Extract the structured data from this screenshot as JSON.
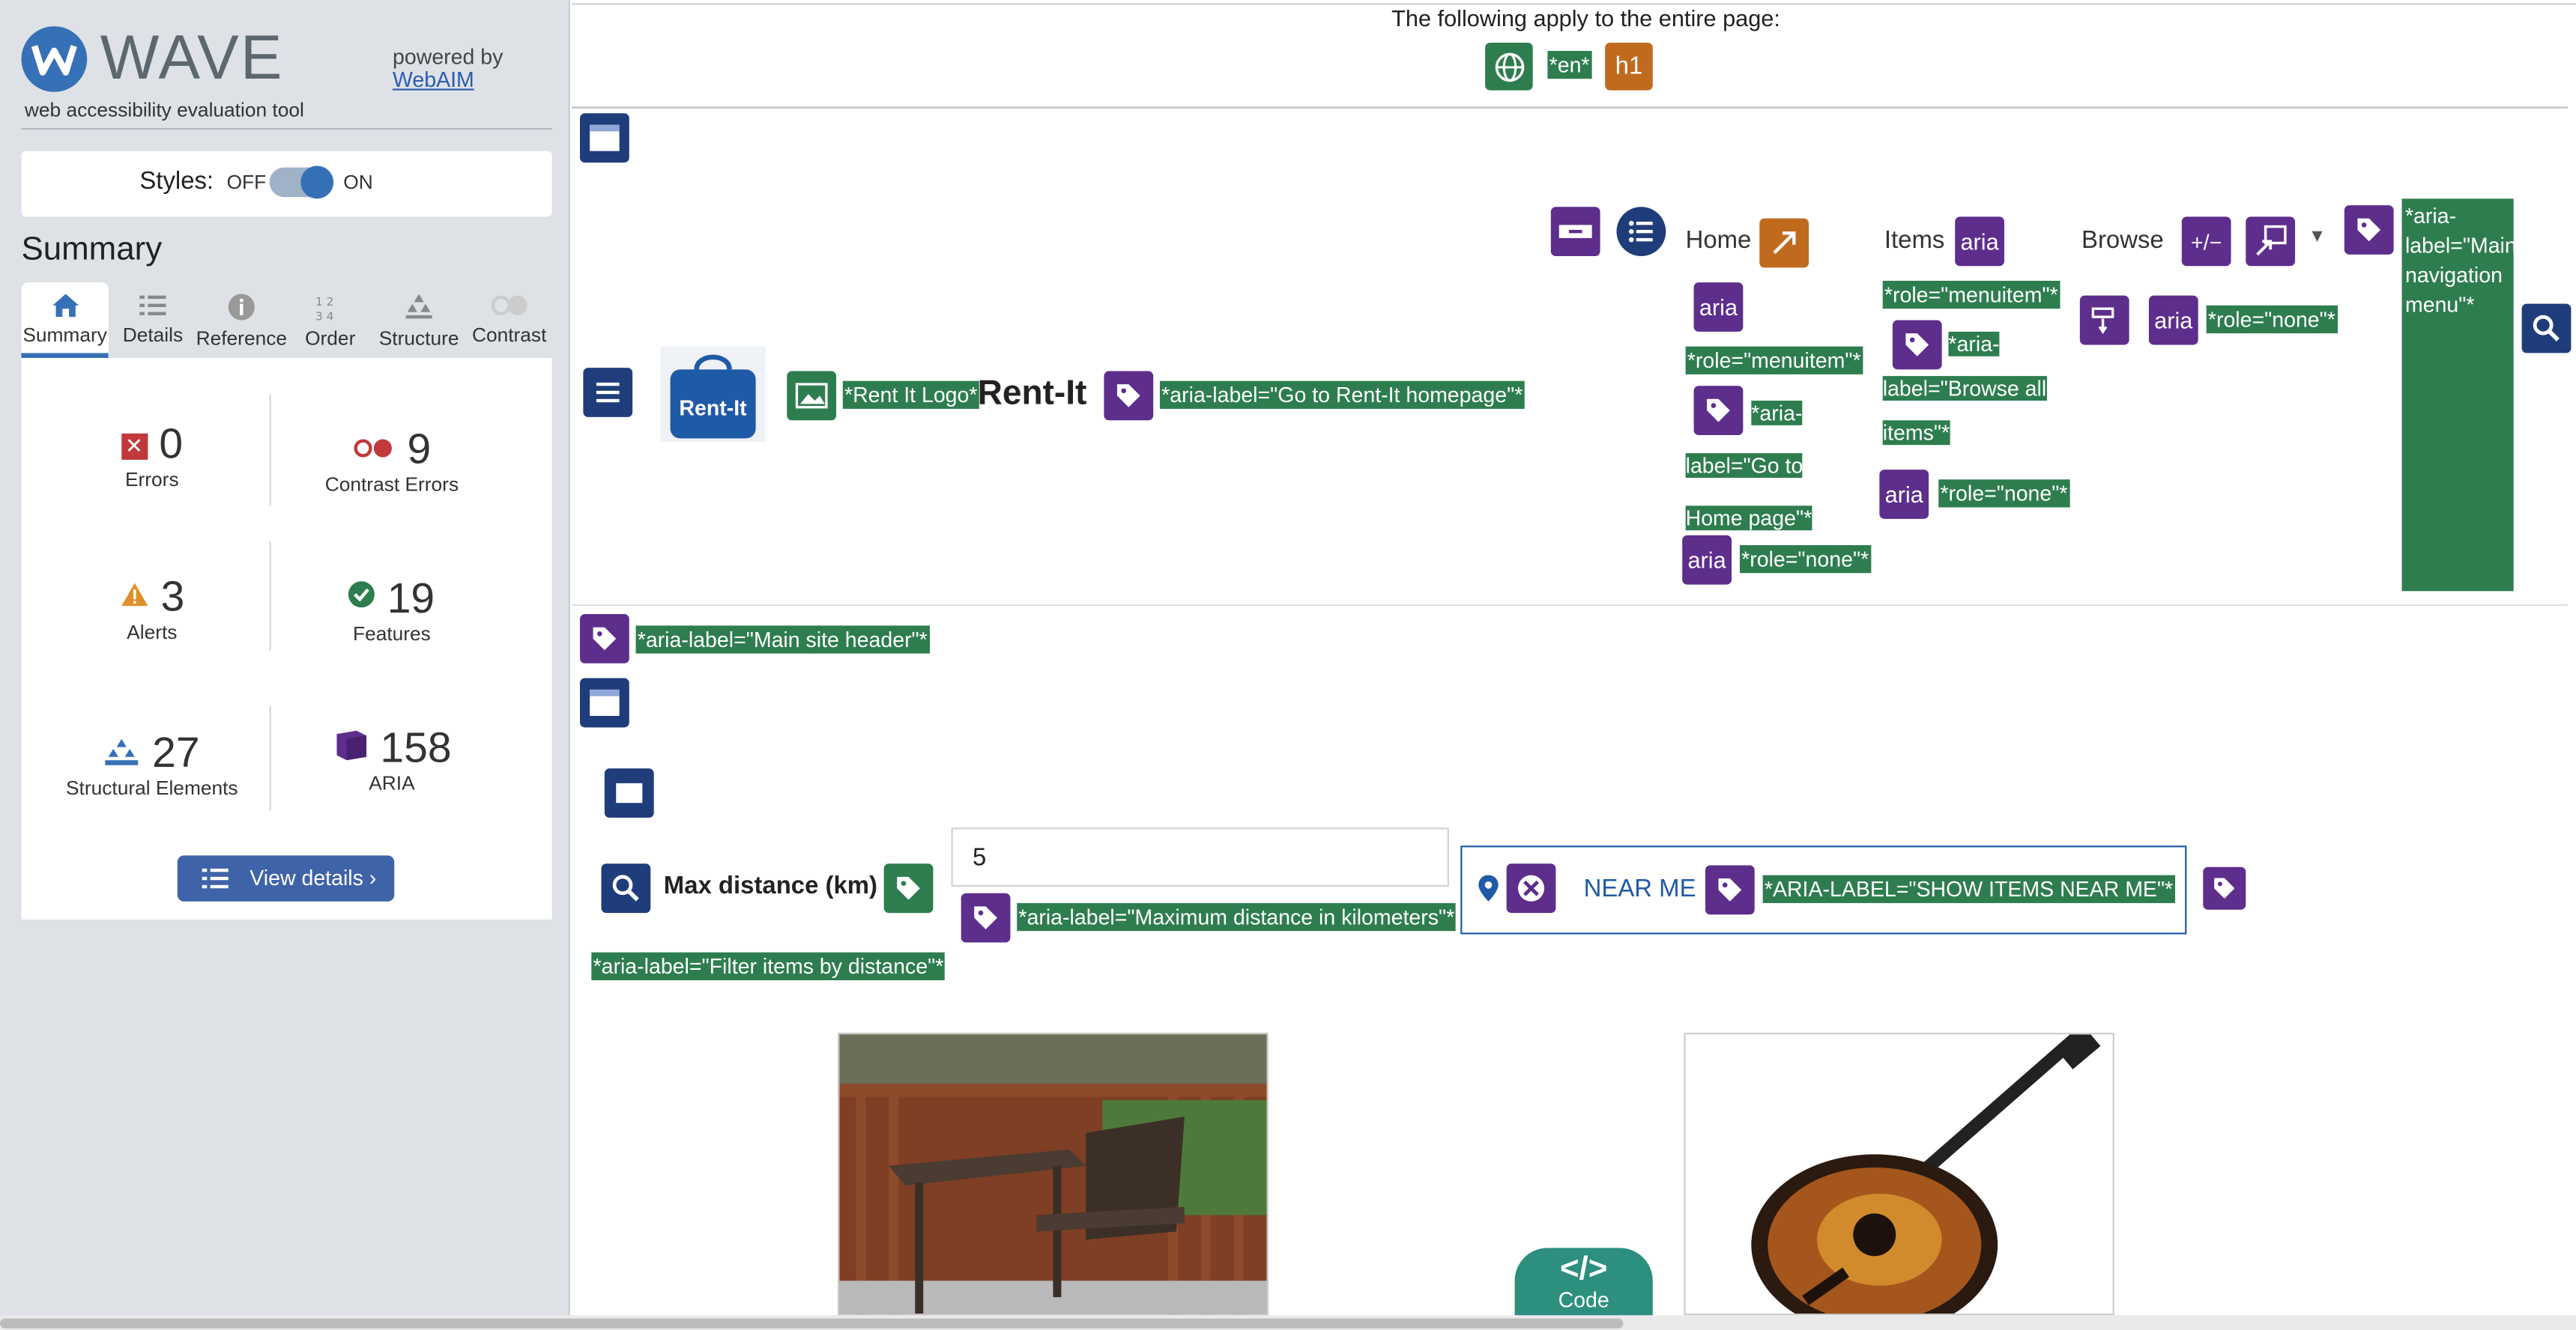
{
  "sidebar": {
    "brand": "WAVE",
    "tagline": "web accessibility evaluation tool",
    "powered_by": "powered by",
    "webaim": "WebAIM",
    "styles_label": "Styles:",
    "styles_off": "OFF",
    "styles_on": "ON",
    "summary_title": "Summary",
    "tabs": [
      "Summary",
      "Details",
      "Reference",
      "Order",
      "Structure",
      "Contrast"
    ],
    "stats": {
      "errors": {
        "value": "0",
        "label": "Errors"
      },
      "contrast": {
        "value": "9",
        "label": "Contrast Errors"
      },
      "alerts": {
        "value": "3",
        "label": "Alerts"
      },
      "features": {
        "value": "19",
        "label": "Features"
      },
      "structural": {
        "value": "27",
        "label": "Structural Elements"
      },
      "aria": {
        "value": "158",
        "label": "ARIA"
      }
    },
    "view_details": "View details ›"
  },
  "page": {
    "entire_page_note": "The following apply to the entire page:",
    "lang_tag": "*en*",
    "h1_icon": "h1",
    "header": {
      "logo_text": "Rent-It",
      "logo_alt": "*Rent It Logo*",
      "brand": "Rent-It",
      "brand_label": "*aria-label=\"Go to Rent-It homepage\"*",
      "nav": {
        "home": "Home",
        "items": "Items",
        "browse": "Browse",
        "aria": "aria",
        "plusminus": "+/−",
        "role_menuitem": "*role=\"menuitem\"*",
        "role_menuitem2": "*role=\"menuitem\"*",
        "home_label": "*aria-label=\"Go to Home page\"*",
        "browse_label": "*aria-label=\"Browse all items\"*",
        "role_none": "*role=\"none\"*",
        "role_none2": "*role=\"none\"*",
        "role_none3": "*role=\"none\"*",
        "main_nav_label": "*aria-label=\"Main navigation menu\"*"
      },
      "site_header_label": "*aria-label=\"Main site header\"*"
    },
    "filter": {
      "max_distance": "Max distance (km)",
      "distance_value": "5",
      "distance_label": "*aria-label=\"Maximum distance in kilometers\"*",
      "near_me": "NEAR ME",
      "near_me_label": "*ARIA-LABEL=\"SHOW ITEMS NEAR ME\"*",
      "filter_label": "*aria-label=\"Filter items by distance\"*"
    },
    "code_button": "Code",
    "code_glyph": "</>"
  },
  "colors": {
    "accent": "#3670b6",
    "green_tag": "#2e7d4f",
    "aria_purple": "#5d2e8c",
    "navy": "#1f3d7a"
  }
}
